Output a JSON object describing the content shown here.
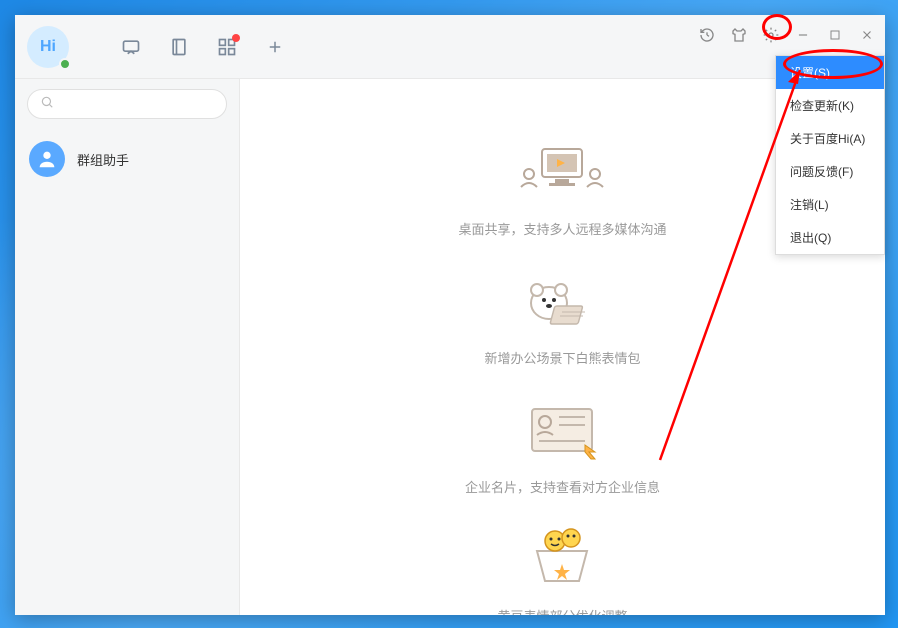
{
  "app": {
    "logo_text": "Hi"
  },
  "sidebar": {
    "search_placeholder": "",
    "contact_name": "群组助手"
  },
  "features": [
    {
      "text": "桌面共享，支持多人远程多媒体沟通"
    },
    {
      "text": "新增办公场景下白熊表情包"
    },
    {
      "text": "企业名片，支持查看对方企业信息"
    },
    {
      "text": "黄豆表情部分优化调整"
    }
  ],
  "menu": {
    "items": [
      {
        "label": "设置(S)",
        "selected": true
      },
      {
        "label": "检查更新(K)",
        "selected": false
      },
      {
        "label": "关于百度Hi(A)",
        "selected": false
      },
      {
        "label": "问题反馈(F)",
        "selected": false
      },
      {
        "label": "注销(L)",
        "selected": false
      },
      {
        "label": "退出(Q)",
        "selected": false
      }
    ]
  }
}
